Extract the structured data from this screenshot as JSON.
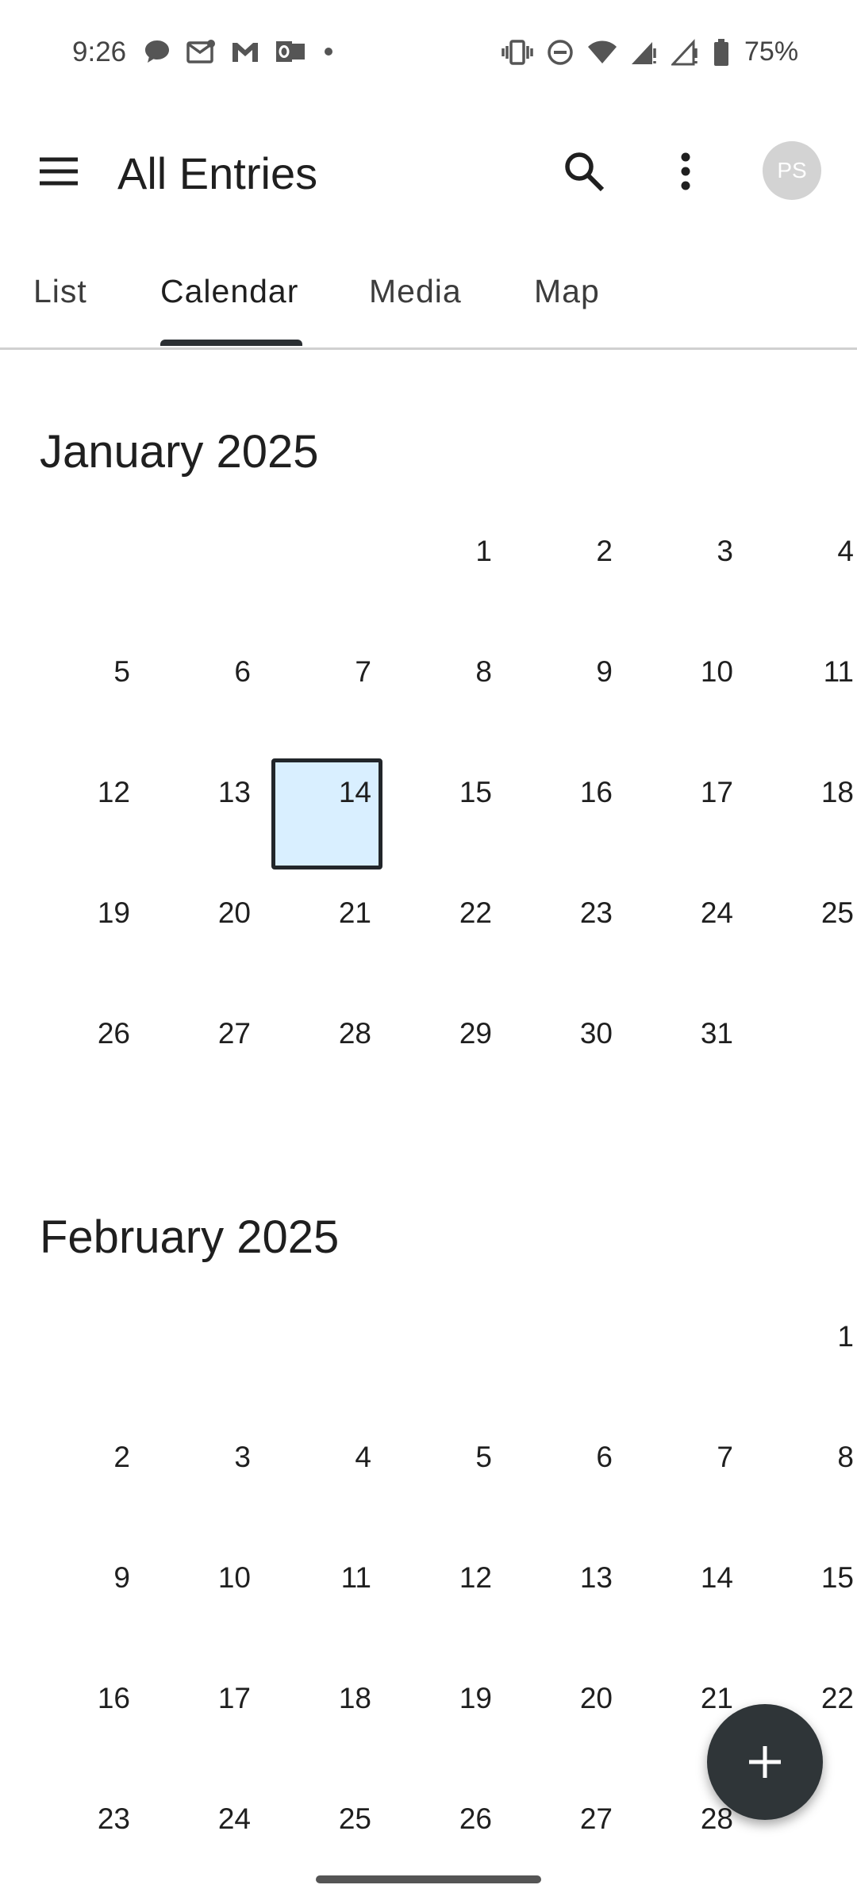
{
  "status_bar": {
    "time": "9:26",
    "battery": "75%"
  },
  "app_bar": {
    "title": "All Entries",
    "avatar_initials": "PS"
  },
  "tabs": [
    {
      "label": "List"
    },
    {
      "label": "Calendar",
      "selected": true
    },
    {
      "label": "Media"
    },
    {
      "label": "Map"
    }
  ],
  "months": [
    {
      "title": "January 2025",
      "first_weekday": 3,
      "days": 31,
      "selected_day": 14,
      "visible_days": 31
    },
    {
      "title": "February 2025",
      "first_weekday": 6,
      "days": 28,
      "selected_day": null,
      "visible_days": 28
    }
  ],
  "colors": {
    "selected_day_bg": "#d9efff",
    "selected_day_border": "#22262a",
    "fab_bg": "#2f3538",
    "tab_indicator": "#2b2f33",
    "avatar_bg": "#d3d3d3"
  },
  "icons": {
    "menu": "menu-icon",
    "search": "search-icon",
    "more": "more-vert-icon",
    "fab": "add-icon"
  }
}
